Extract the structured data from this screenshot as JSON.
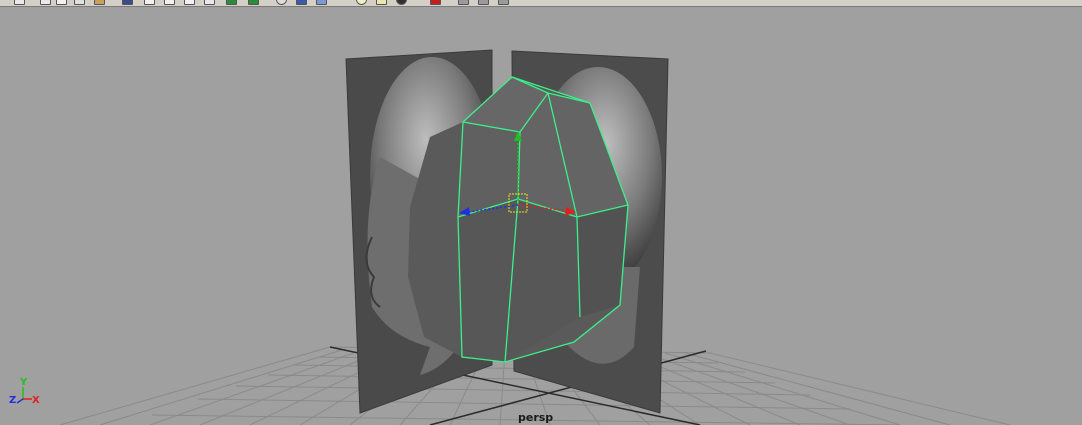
{
  "toolbar": {
    "icons": [
      "snap-grid-icon",
      "snap-curve-icon",
      "snap-point-icon",
      "snap-view-icon",
      "snap-surface-icon",
      "render-view-icon",
      "render-current-icon",
      "ipr-render-icon",
      "render-settings-icon",
      "hypershade-icon",
      "show-hide-tool-icon",
      "outliner-icon",
      "sphere-icon",
      "cube-icon",
      "cylinder-icon",
      "light-icon",
      "camera-icon",
      "sculpt-icon",
      "mirror-icon",
      "smooth-icon",
      "undo-icon"
    ]
  },
  "viewport": {
    "camera_label": "persp",
    "axis": {
      "y": "Y",
      "z": "Z",
      "x": "X"
    },
    "selection_color": "#3cf08a",
    "axis_colors": {
      "x": "#e02020",
      "y": "#20c020",
      "z": "#2030e0"
    }
  }
}
